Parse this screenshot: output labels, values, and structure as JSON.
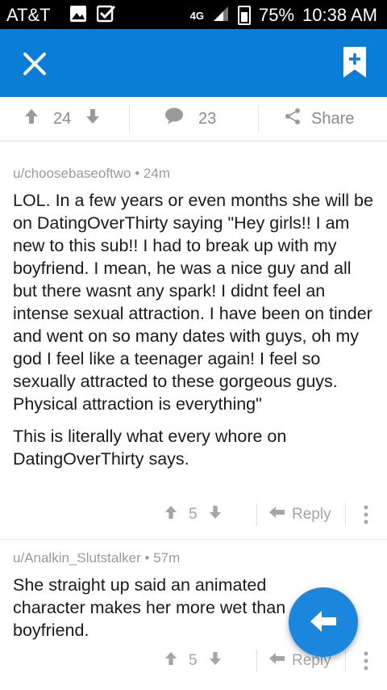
{
  "status_bar": {
    "carrier": "AT&T",
    "network": "4G",
    "battery": "75%",
    "time": "10:38 AM"
  },
  "post_actions": {
    "upvotes": "24",
    "comments": "23",
    "share_label": "Share"
  },
  "comments": [
    {
      "author": "u/choosebaseoftwo",
      "age": "24m",
      "paragraphs": [
        "LOL. In a few years or even months she will be on DatingOverThirty saying \"Hey girls!! I am new to this sub!! I had to break up with my boyfriend. I mean, he was a nice guy and all but there wasnt any spark! I didnt feel an intense sexual attraction. I have been on tinder and went on so many dates with guys, oh my god I feel like a teenager again! I feel so sexually attracted to these gorgeous guys. Physical attraction is everything\"",
        "This is literally what every whore on DatingOverThirty says."
      ],
      "score": "5",
      "reply_label": "Reply"
    },
    {
      "author": "u/Analkin_Slutstalker",
      "age": "57m",
      "paragraphs": [
        "She straight up said an animated character makes her more wet than boyfriend."
      ],
      "score": "5",
      "reply_label": "Reply"
    }
  ],
  "colors": {
    "app_bar": "#0a7ed6",
    "fab": "#1a87dd",
    "status_bar": "#000000"
  }
}
